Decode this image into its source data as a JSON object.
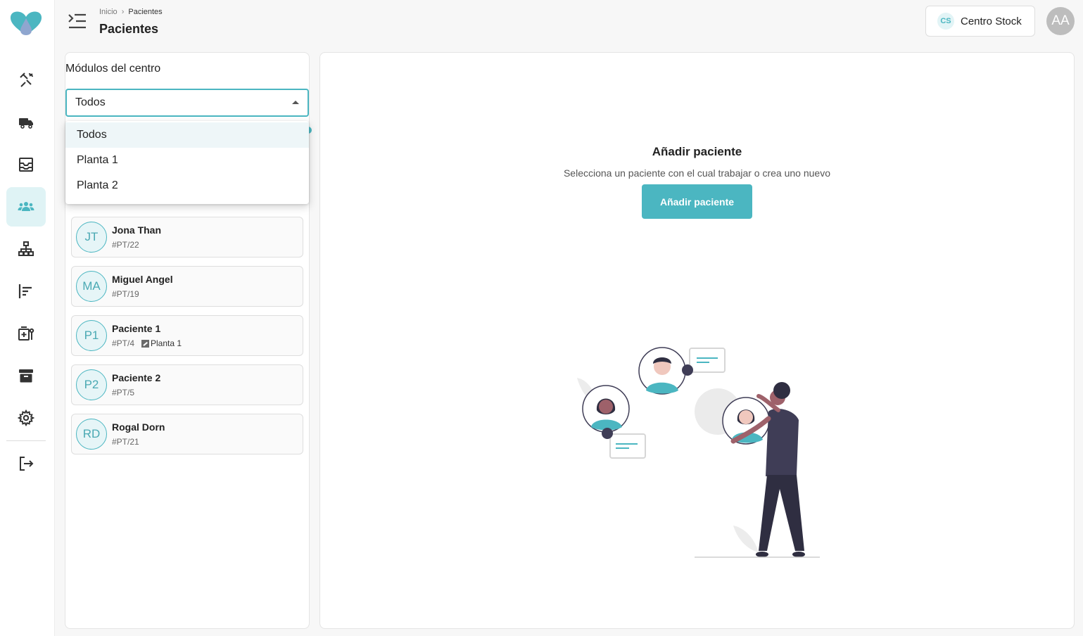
{
  "header": {
    "breadcrumb": [
      {
        "label": "Inicio"
      },
      {
        "label": "Pacientes"
      }
    ],
    "page_title": "Pacientes",
    "center": {
      "badge": "CS",
      "label": "Centro Stock"
    },
    "user_initials": "AA"
  },
  "sidebar": {
    "items": [
      {
        "icon": "tool-icon",
        "active": false
      },
      {
        "icon": "truck-icon",
        "active": false
      },
      {
        "icon": "inbox-icon",
        "active": false
      },
      {
        "icon": "users-icon",
        "active": true
      },
      {
        "icon": "sitemap-icon",
        "active": false
      },
      {
        "icon": "align-left-icon",
        "active": false
      },
      {
        "icon": "medical-icon",
        "active": false
      },
      {
        "icon": "archive-icon",
        "active": false
      },
      {
        "icon": "gear-icon",
        "active": false
      }
    ],
    "logout_icon": "logout-icon"
  },
  "filter": {
    "label": "Módulos del centro",
    "selected": "Todos",
    "options": [
      "Todos",
      "Planta 1",
      "Planta 2"
    ]
  },
  "patients": [
    {
      "initials": "JT",
      "name": "Jona Than",
      "code": "#PT/22",
      "plant": ""
    },
    {
      "initials": "MA",
      "name": "Miguel Angel",
      "code": "#PT/19",
      "plant": ""
    },
    {
      "initials": "P1",
      "name": "Paciente 1",
      "code": "#PT/4",
      "plant": "Planta 1"
    },
    {
      "initials": "P2",
      "name": "Paciente 2",
      "code": "#PT/5",
      "plant": ""
    },
    {
      "initials": "RD",
      "name": "Rogal Dorn",
      "code": "#PT/21",
      "plant": ""
    }
  ],
  "main": {
    "title": "Añadir paciente",
    "subtitle": "Selecciona un paciente con el cual trabajar o crea uno nuevo",
    "button_label": "Añadir paciente"
  },
  "colors": {
    "accent": "#4bb6c1",
    "accent_light": "#dff3f5",
    "text": "#222222"
  }
}
